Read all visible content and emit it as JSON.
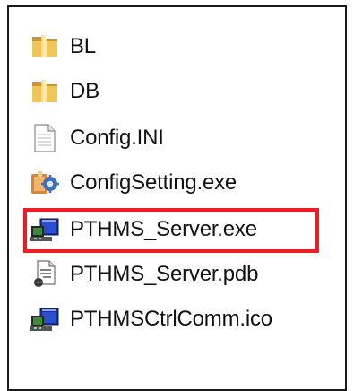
{
  "files": [
    {
      "name": "BL",
      "icon": "folder-icon"
    },
    {
      "name": "DB",
      "icon": "folder-icon"
    },
    {
      "name": "Config.INI",
      "icon": "ini-file-icon"
    },
    {
      "name": "ConfigSetting.exe",
      "icon": "config-app-icon"
    },
    {
      "name": "PTHMS_Server.exe",
      "icon": "app-window-icon"
    },
    {
      "name": "PTHMS_Server.pdb",
      "icon": "pdb-file-icon"
    },
    {
      "name": "PTHMSCtrlComm.ico",
      "icon": "app-window-icon"
    }
  ],
  "highlight_color": "#ef1c24",
  "folder_color": "#e8b84a"
}
